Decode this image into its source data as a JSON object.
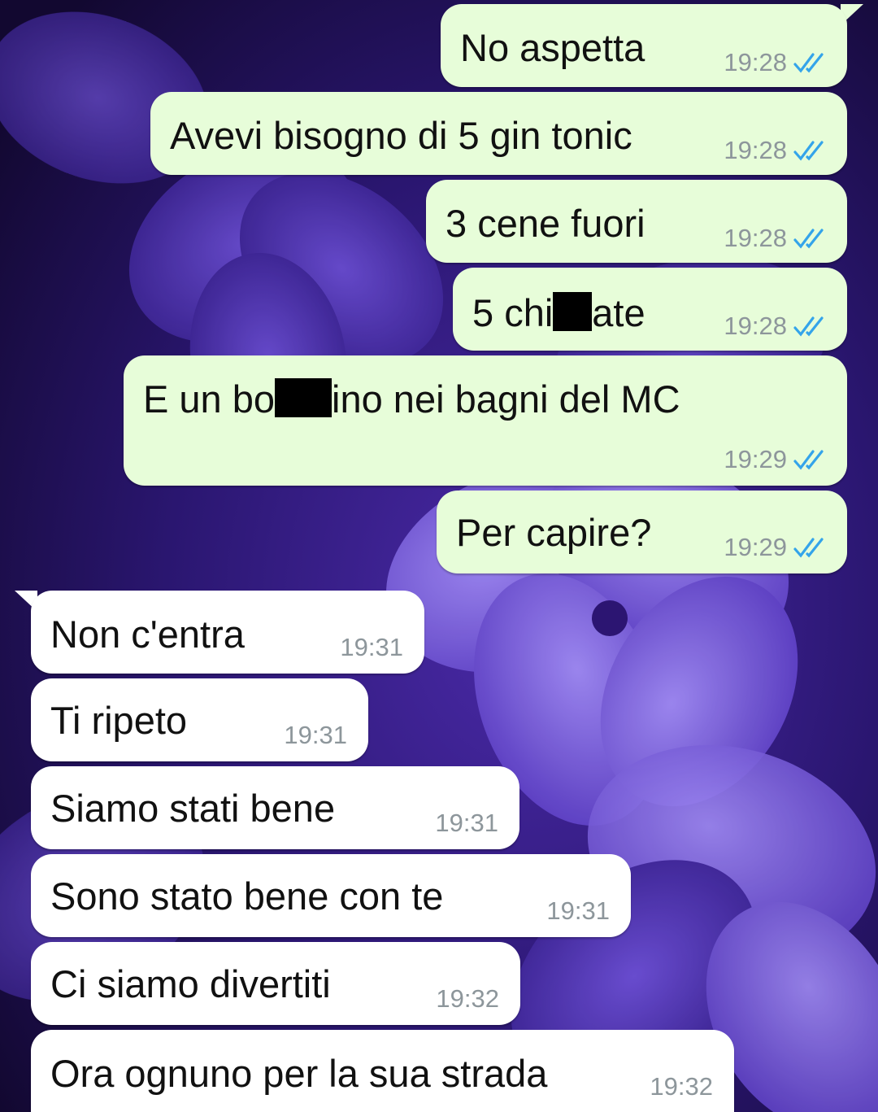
{
  "chat": {
    "background": {
      "palette": [
        "#1a0d3d",
        "#3b1f8a",
        "#5b3fc4",
        "#7a5ce0",
        "#9c86f0"
      ]
    },
    "colors": {
      "outgoing_bubble": "#e7fdd9",
      "incoming_bubble": "#ffffff",
      "read_ticks": "#34a4ea",
      "timestamp": "#8d969b"
    },
    "messages": [
      {
        "direction": "out",
        "text": "No aspetta",
        "time": "19:28",
        "status": "read"
      },
      {
        "direction": "out",
        "text": "Avevi bisogno di 5 gin tonic",
        "time": "19:28",
        "status": "read"
      },
      {
        "direction": "out",
        "text": "3 cene fuori",
        "time": "19:28",
        "status": "read"
      },
      {
        "direction": "out",
        "text_parts": [
          "5 chi",
          "ate"
        ],
        "time": "19:28",
        "status": "read",
        "redacted": true
      },
      {
        "direction": "out",
        "text_parts": [
          "E un bo",
          "ino nei bagni del MC"
        ],
        "time": "19:29",
        "status": "read",
        "redacted": true
      },
      {
        "direction": "out",
        "text": "Per capire?",
        "time": "19:29",
        "status": "read"
      },
      {
        "direction": "in",
        "text": "Non c'entra",
        "time": "19:31"
      },
      {
        "direction": "in",
        "text": "Ti ripeto",
        "time": "19:31"
      },
      {
        "direction": "in",
        "text": "Siamo stati bene",
        "time": "19:31"
      },
      {
        "direction": "in",
        "text": "Sono stato bene con te",
        "time": "19:31"
      },
      {
        "direction": "in",
        "text": "Ci siamo divertiti",
        "time": "19:32"
      },
      {
        "direction": "in",
        "text": "Ora ognuno per la sua strada",
        "time": "19:32"
      }
    ]
  }
}
